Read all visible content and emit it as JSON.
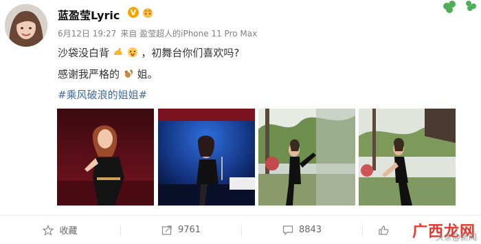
{
  "user": {
    "name": "蓝盈莹Lyric",
    "verified_badge": "V",
    "crown_badge": "crown-icon"
  },
  "post": {
    "date": "6月12日 19:27",
    "source": "来自 盈莹超人的iPhone 11 Pro Max",
    "line1_a": "沙袋没白背",
    "line1_b": "，初舞台你们喜欢吗?",
    "line2_a": "感谢我严格的",
    "line2_b": "姐。",
    "hashtag": "#乘风破浪的姐姐#"
  },
  "actions": {
    "favorite_label": "收藏",
    "repost_count": "9761",
    "comment_count": "8843"
  },
  "watermark": {
    "brand": "广西龙网",
    "sub": "头条@新闻"
  },
  "colors": {
    "hashtag": "#3b6cb5",
    "meta": "#808080",
    "watermark": "#e8362a"
  }
}
